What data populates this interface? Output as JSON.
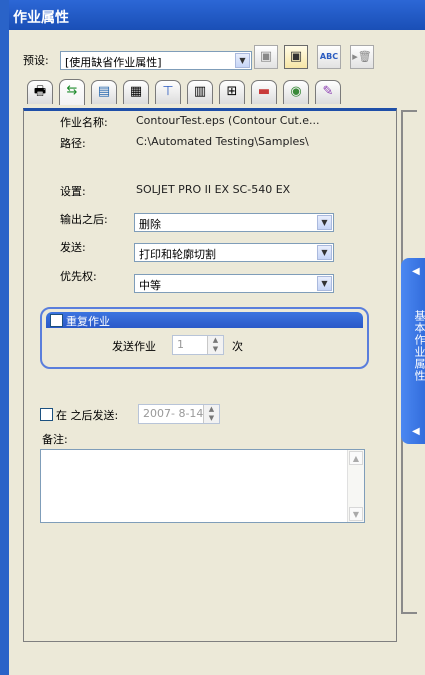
{
  "window": {
    "title": "作业属性"
  },
  "preset": {
    "label": "预设:",
    "value": "[使用缺省作业属性]",
    "toolbar": [
      {
        "icon": "save-disabled-icon",
        "glyph": "▣"
      },
      {
        "icon": "save-icon",
        "glyph": "▣"
      },
      {
        "icon": "spell-check-icon",
        "glyph": "ABC"
      },
      {
        "icon": "delete-icon",
        "glyph": "▸🗑"
      }
    ]
  },
  "tabs": [
    {
      "icon": "printer-icon",
      "glyph": "🖶"
    },
    {
      "icon": "job-info-icon",
      "glyph": "⇆"
    },
    {
      "icon": "image-icon",
      "glyph": "▤"
    },
    {
      "icon": "layout-icon",
      "glyph": "▦"
    },
    {
      "icon": "cutter-icon",
      "glyph": "⊤"
    },
    {
      "icon": "tiling-icon",
      "glyph": "▥"
    },
    {
      "icon": "marks-icon",
      "glyph": "⊞"
    },
    {
      "icon": "color-bars-icon",
      "glyph": "▬"
    },
    {
      "icon": "color-management-icon",
      "glyph": "◉"
    },
    {
      "icon": "color-edit-icon",
      "glyph": "✎"
    }
  ],
  "info": {
    "job_name_label": "作业名称:",
    "job_name_value": "ContourTest.eps (Contour Cut.e...",
    "path_label": "路径:",
    "path_value": "C:\\Automated Testing\\Samples\\",
    "device_label": "设置:",
    "device_value": "SOLJET PRO II EX SC-540 EX"
  },
  "fields": {
    "after_output_label": "输出之后:",
    "after_output_value": "删除",
    "send_label": "发送:",
    "send_value": "打印和轮廓切割",
    "priority_label": "优先权:",
    "priority_value": "中等"
  },
  "repeat": {
    "title": "重复作业",
    "send_job_label": "发送作业",
    "count_value": "1",
    "unit": "次"
  },
  "schedule": {
    "label": "在 之后发送:",
    "date_value": "2007- 8-14"
  },
  "notes": {
    "label": "备注:",
    "value": ""
  },
  "side_tab": {
    "label": "基本作业属性"
  }
}
